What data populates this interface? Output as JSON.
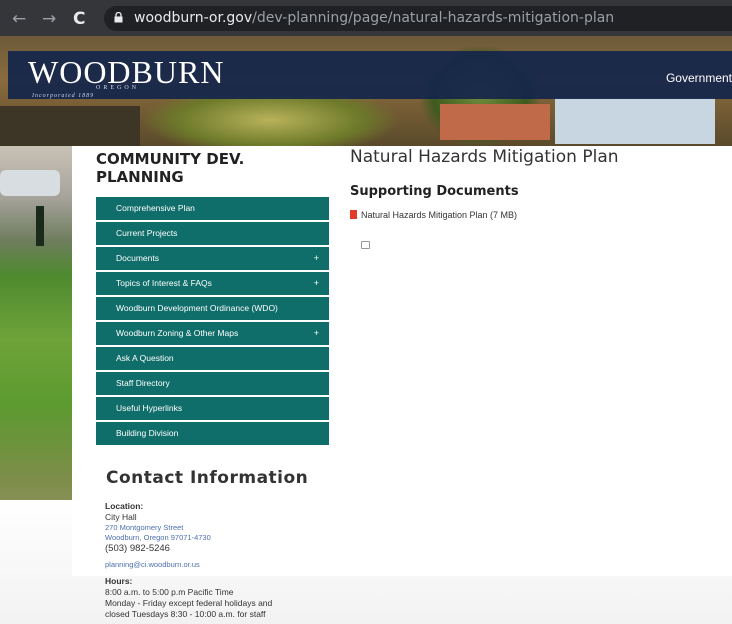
{
  "browser": {
    "back_glyph": "←",
    "forward_glyph": "→",
    "reload_glyph": "C",
    "url_domain": "woodburn-or.gov",
    "url_path": "/dev-planning/page/natural-hazards-mitigation-plan"
  },
  "header": {
    "logo": "WOODBURN",
    "logo_sub": "OREGON",
    "logo_inc": "Incorporated 1889",
    "top_nav_label": "Government"
  },
  "sidebar": {
    "section_title": "COMMUNITY DEV. PLANNING",
    "menu": [
      {
        "label": "Comprehensive Plan",
        "expand": ""
      },
      {
        "label": "Current Projects",
        "expand": ""
      },
      {
        "label": "Documents",
        "expand": "+"
      },
      {
        "label": "Topics of Interest & FAQs",
        "expand": "+"
      },
      {
        "label": "Woodburn Development Ordinance (WDO)",
        "expand": ""
      },
      {
        "label": "Woodburn Zoning & Other Maps",
        "expand": "+"
      },
      {
        "label": "Ask A Question",
        "expand": ""
      },
      {
        "label": "Staff Directory",
        "expand": ""
      },
      {
        "label": "Useful Hyperlinks",
        "expand": ""
      },
      {
        "label": "Building Division",
        "expand": ""
      }
    ]
  },
  "main": {
    "title": "Natural Hazards Mitigation Plan",
    "subtitle": "Supporting Documents",
    "doc_link": "Natural Hazards Mitigation Plan (7 MB)"
  },
  "contact": {
    "title": "Contact Information",
    "location_label": "Location:",
    "location_name": "City Hall",
    "address_line1": "270 Montgomery Street",
    "address_line2": "Woodburn, Oregon 97071-4730",
    "phone": "(503) 982-5246",
    "email": "planning@ci.woodburn.or.us",
    "hours_label": "Hours:",
    "hours_line1": "8:00 a.m. to 5:00 p.m Pacific Time",
    "hours_line2": "Monday - Friday except federal holidays and",
    "hours_line3": "closed Tuesdays 8:30 - 10:00 a.m. for staff"
  },
  "colors": {
    "menu_teal": "#0f6d6a",
    "banner_navy": "#14264b",
    "link_blue": "#4d6fb0",
    "pdf_red": "#e23b2b"
  }
}
